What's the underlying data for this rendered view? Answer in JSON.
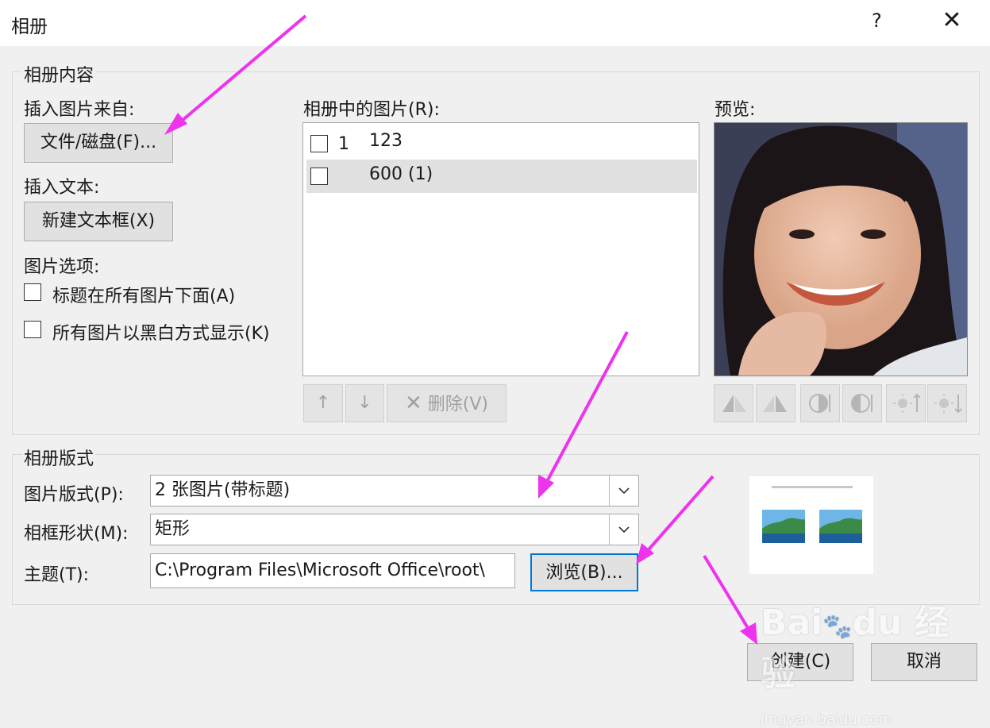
{
  "window": {
    "title": "相册",
    "help": "?",
    "close": "✕"
  },
  "content": {
    "legend": "相册内容",
    "insert_from": "插入图片来自:",
    "file_disk_button": "文件/磁盘(F)...",
    "insert_text": "插入文本:",
    "new_textbox_button": "新建文本框(X)",
    "picture_options": "图片选项:",
    "options": [
      {
        "label": "标题在所有图片下面(A)",
        "checked": false
      },
      {
        "label": "所有图片以黑白方式显示(K)",
        "checked": false
      }
    ],
    "pictures_label": "相册中的图片(R):",
    "pictures": [
      {
        "index": "1",
        "name": "123",
        "checked": false,
        "selected": false
      },
      {
        "index": "",
        "name": "600 (1)",
        "checked": false,
        "selected": true
      }
    ],
    "up_icon": "↑",
    "down_icon": "↓",
    "delete_button": "删除(V)",
    "preview_label": "预览:"
  },
  "layout": {
    "legend": "相册版式",
    "picture_layout_label": "图片版式(P):",
    "picture_layout_value": "2 张图片(带标题)",
    "frame_shape_label": "相框形状(M):",
    "frame_shape_value": "矩形",
    "theme_label": "主题(T):",
    "theme_value": "C:\\Program Files\\Microsoft Office\\root\\",
    "browse_button": "浏览(B)..."
  },
  "footer": {
    "create_button": "创建(C)",
    "cancel_button": "取消"
  },
  "watermark": "Bai du 经验 jingyan.baidu.com",
  "colors": {
    "annotation_arrow": "#ee33ee",
    "selected_row": "#e1e1e1"
  }
}
